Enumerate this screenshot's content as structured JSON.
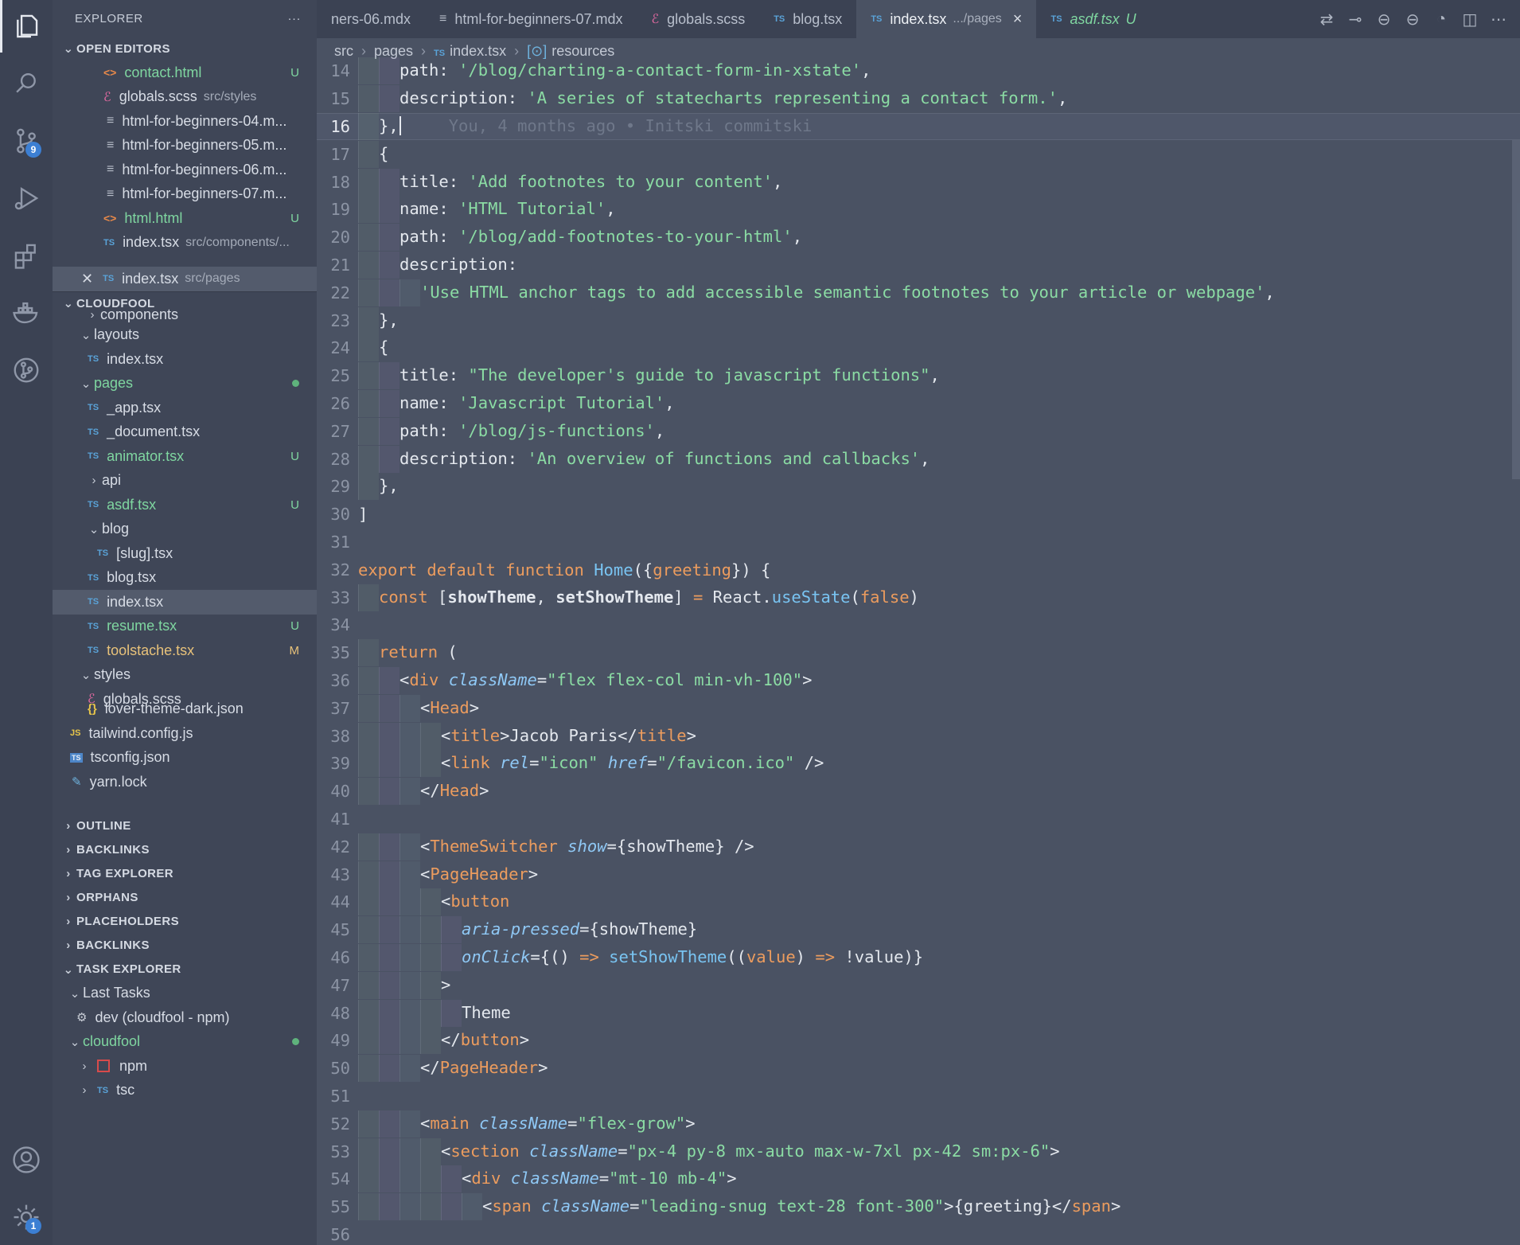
{
  "activity": {
    "scm_badge": "9",
    "settings_badge": "1"
  },
  "sidebar": {
    "title": "EXPLORER",
    "more": "···",
    "open_editors": {
      "label": "OPEN EDITORS",
      "items": [
        {
          "name": "contact.html",
          "desc": "",
          "status": "U",
          "kind": "html"
        },
        {
          "name": "globals.scss",
          "desc": "src/styles",
          "status": "",
          "kind": "scss"
        },
        {
          "name": "html-for-beginners-04.m...",
          "desc": "",
          "status": "",
          "kind": "md"
        },
        {
          "name": "html-for-beginners-05.m...",
          "desc": "",
          "status": "",
          "kind": "md"
        },
        {
          "name": "html-for-beginners-06.m...",
          "desc": "",
          "status": "",
          "kind": "md"
        },
        {
          "name": "html-for-beginners-07.m...",
          "desc": "",
          "status": "",
          "kind": "md"
        },
        {
          "name": "html.html",
          "desc": "",
          "status": "U",
          "kind": "html"
        },
        {
          "name": "index.tsx",
          "desc": "src/components/...",
          "status": "",
          "kind": "ts"
        },
        {
          "name": "index.tsx",
          "desc": "src/pages",
          "status": "",
          "kind": "ts"
        }
      ]
    },
    "project": {
      "label": "CLOUDFOOL",
      "items": [
        {
          "name": "components",
          "status": ""
        },
        {
          "name": "layouts",
          "status": ""
        },
        {
          "name": "index.tsx",
          "status": ""
        },
        {
          "name": "pages",
          "status": ""
        },
        {
          "name": "_app.tsx",
          "status": ""
        },
        {
          "name": "_document.tsx",
          "status": ""
        },
        {
          "name": "animator.tsx",
          "status": "U"
        },
        {
          "name": "api",
          "status": ""
        },
        {
          "name": "asdf.tsx",
          "status": "U"
        },
        {
          "name": "blog",
          "status": ""
        },
        {
          "name": "[slug].tsx",
          "status": ""
        },
        {
          "name": "blog.tsx",
          "status": ""
        },
        {
          "name": "index.tsx",
          "status": ""
        },
        {
          "name": "resume.tsx",
          "status": "U"
        },
        {
          "name": "toolstache.tsx",
          "status": "M"
        },
        {
          "name": "styles",
          "status": ""
        },
        {
          "name": "globals.scss",
          "status": ""
        },
        {
          "name": "lover-theme-dark.json",
          "status": ""
        },
        {
          "name": "tailwind.config.js",
          "status": ""
        },
        {
          "name": "tsconfig.json",
          "status": ""
        },
        {
          "name": "yarn.lock",
          "status": ""
        }
      ]
    },
    "panels": [
      "OUTLINE",
      "BACKLINKS",
      "TAG EXPLORER",
      "ORPHANS",
      "PLACEHOLDERS",
      "BACKLINKS"
    ],
    "task_explorer": {
      "label": "TASK EXPLORER",
      "last_tasks": "Last Tasks",
      "dev_task": "dev (cloudfool - npm)",
      "cloudfool": "cloudfool",
      "npm": "npm",
      "tsc": "tsc"
    }
  },
  "tabs": [
    {
      "label": "ners-06.mdx",
      "kind": "md"
    },
    {
      "label": "html-for-beginners-07.mdx",
      "kind": "md"
    },
    {
      "label": "globals.scss",
      "kind": "scss"
    },
    {
      "label": "blog.tsx",
      "kind": "ts"
    },
    {
      "label": "index.tsx",
      "desc": ".../pages",
      "kind": "ts"
    },
    {
      "label": "asdf.tsx",
      "desc": "U",
      "kind": "ts"
    }
  ],
  "breadcrumb": {
    "src": "src",
    "pages": "pages",
    "file": "index.tsx",
    "symbol": "resources"
  },
  "editor": {
    "blame": "You, 4 months ago • Initski commitski",
    "line_numbers": [
      "14",
      "15",
      "16",
      "17",
      "18",
      "19",
      "20",
      "21",
      "22",
      "23",
      "24",
      "25",
      "26",
      "27",
      "28",
      "29",
      "30",
      "31",
      "32",
      "33",
      "34",
      "35",
      "36",
      "37",
      "38",
      "39",
      "40",
      "41",
      "42",
      "43",
      "44",
      "45",
      "46",
      "47",
      "48",
      "49",
      "50",
      "51",
      "52",
      "53",
      "54",
      "55",
      "56"
    ],
    "strings": {
      "l14": "'/blog/charting-a-contact-form-in-xstate'",
      "l15": "'A series of statecharts representing a contact form.'",
      "l18": "'Add footnotes to your content'",
      "l19": "'HTML Tutorial'",
      "l20": "'/blog/add-footnotes-to-your-html'",
      "l22": "'Use HTML anchor tags to add accessible semantic footnotes to your article or webpage'",
      "l25": "\"The developer's guide to javascript functions\"",
      "l26": "'Javascript Tutorial'",
      "l27": "'/blog/js-functions'",
      "l28": "'An overview of functions and callbacks'",
      "l36": "\"flex flex-col min-vh-100\"",
      "l38": "Jacob Paris",
      "l39a": "\"icon\"",
      "l39b": "\"/favicon.ico\"",
      "l48": "Theme",
      "l52": "\"flex-grow\"",
      "l53": "\"px-4 py-8 mx-auto max-w-7xl px-42 sm:px-6\"",
      "l54": "\"mt-10 mb-4\"",
      "l55": "\"leading-snug text-28 font-300\""
    }
  }
}
